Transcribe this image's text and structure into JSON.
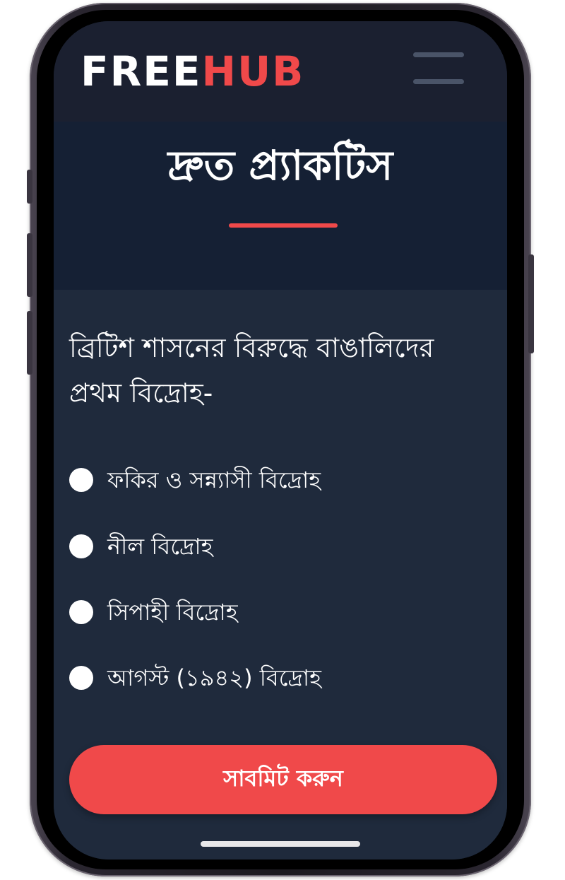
{
  "brand": {
    "part1": "FREE",
    "part2": "HUB",
    "accent_color": "#f0494a"
  },
  "header": {
    "menu_icon": "hamburger-menu-icon"
  },
  "hero": {
    "title": "দ্রুত প্র্যাকটিস"
  },
  "quiz": {
    "question": "ব্রিটিশ শাসনের বিরুদ্ধে বাঙালিদের প্রথম বিদ্রোহ-",
    "options": [
      {
        "label": "ফকির ও সন্ন্যাসী বিদ্রোহ",
        "selected": false
      },
      {
        "label": "নীল বিদ্রোহ",
        "selected": false
      },
      {
        "label": "সিপাহী বিদ্রোহ",
        "selected": false
      },
      {
        "label": "আগস্ট (১৯৪২) বিদ্রোহ",
        "selected": false
      }
    ],
    "submit_label": "সাবমিট করুন"
  },
  "colors": {
    "background": "#1f2a3c",
    "header": "#1b2030",
    "hero": "#152034",
    "button": "#f0494a"
  }
}
